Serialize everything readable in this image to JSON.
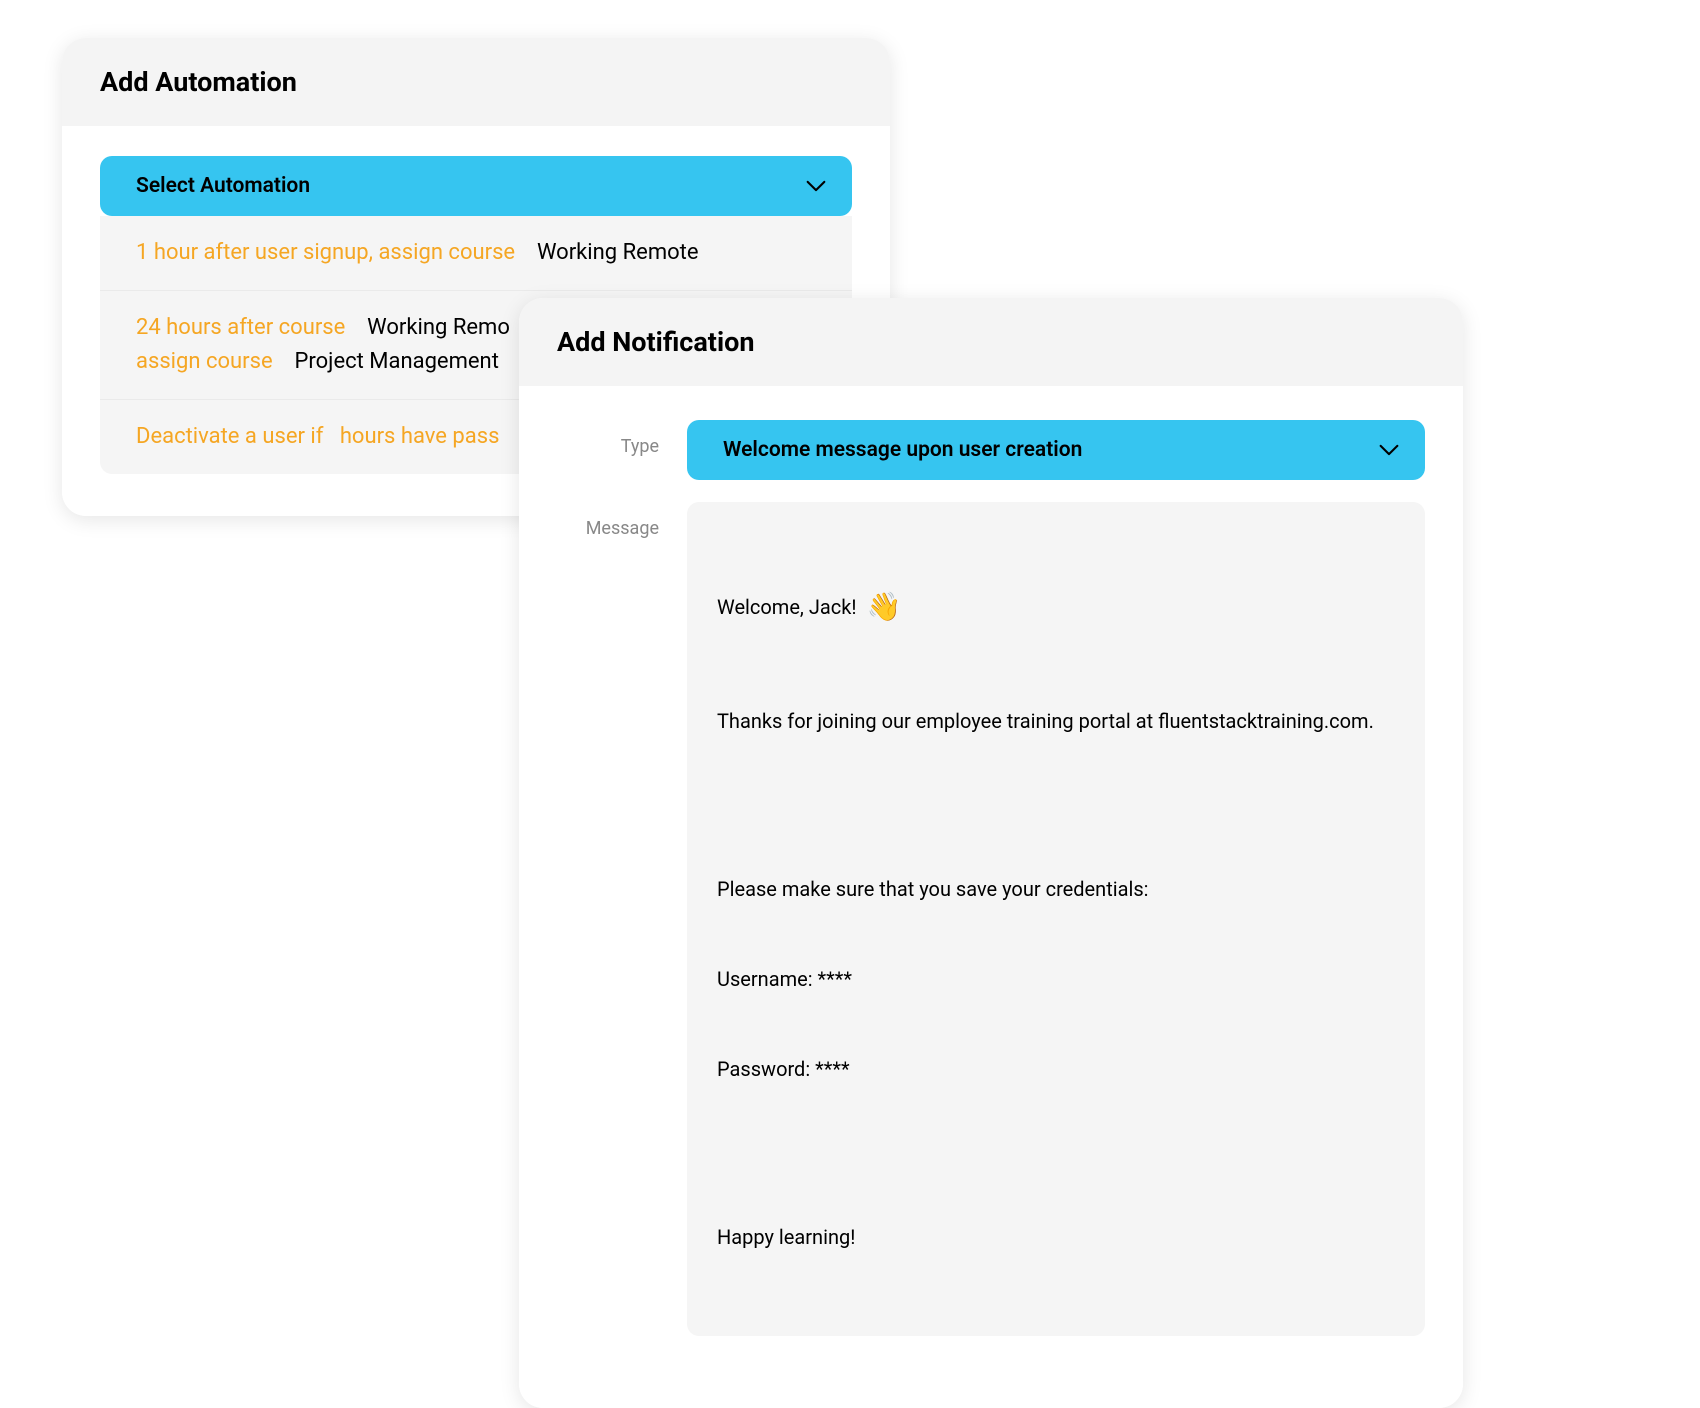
{
  "colors": {
    "accent_blue": "#36c5f0",
    "accent_orange": "#f5a623"
  },
  "automation_card": {
    "title": "Add Automation",
    "select": {
      "label": "Select Automation"
    },
    "items": [
      {
        "prefix": "1 hour after user signup, assign course",
        "value": "Working Remote"
      },
      {
        "prefix": "24 hours after course",
        "value1": "Working Remo",
        "prefix2": "assign course",
        "value2": "Project Management"
      },
      {
        "prefix": "Deactivate a user if",
        "prefix2": "hours have pass"
      }
    ]
  },
  "notification_card": {
    "title": "Add Notification",
    "type_label": "Type",
    "type_value": "Welcome message upon user creation",
    "message_label": "Message",
    "message": {
      "greeting": "Welcome, Jack!",
      "wave": "👋",
      "line2": "Thanks for joining our employee training portal at fluentstacktraining.com.",
      "line3": "Please make sure that you save your credentials:",
      "username_line": "Username: ****",
      "password_line": "Password: ****",
      "closing": "Happy learning!"
    }
  }
}
